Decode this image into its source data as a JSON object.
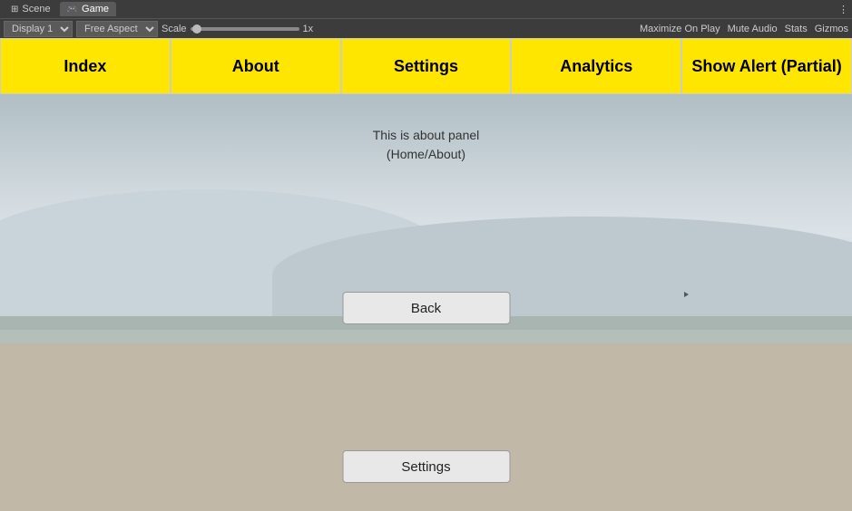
{
  "topbar": {
    "scene_tab": "Scene",
    "game_tab": "Game",
    "display_label": "Display 1",
    "aspect_label": "Free Aspect",
    "scale_label": "Scale",
    "scale_value": "1x",
    "maximize_label": "Maximize On Play",
    "mute_label": "Mute Audio",
    "stats_label": "Stats",
    "gizmos_label": "Gizmos",
    "more_icon": "⋮"
  },
  "nav": {
    "tabs": [
      {
        "label": "Index"
      },
      {
        "label": "About"
      },
      {
        "label": "Settings"
      },
      {
        "label": "Analytics"
      },
      {
        "label": "Show Alert (Partial)"
      }
    ]
  },
  "content": {
    "about_line1": "This is about panel",
    "about_line2": "(Home/About)",
    "back_button": "Back",
    "settings_button": "Settings"
  }
}
